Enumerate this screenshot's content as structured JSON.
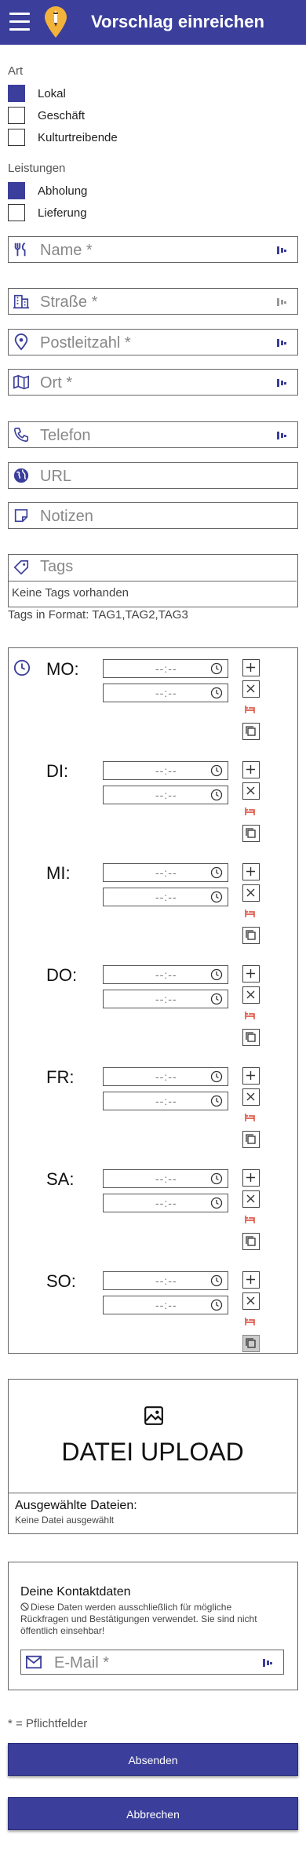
{
  "header": {
    "title": "Vorschlag einreichen"
  },
  "art": {
    "label": "Art",
    "options": [
      {
        "label": "Lokal",
        "checked": true
      },
      {
        "label": "Geschäft",
        "checked": false
      },
      {
        "label": "Kulturtreibende",
        "checked": false
      }
    ]
  },
  "leistungen": {
    "label": "Leistungen",
    "options": [
      {
        "label": "Abholung",
        "checked": true
      },
      {
        "label": "Lieferung",
        "checked": false
      }
    ]
  },
  "fields": {
    "name": "Name *",
    "strasse": "Straße *",
    "postleitzahl": "Postleitzahl *",
    "ort": "Ort *",
    "telefon": "Telefon",
    "url": "URL",
    "notizen": "Notizen",
    "tags": "Tags"
  },
  "tags": {
    "empty": "Keine Tags vorhanden",
    "hint": "Tags in Format: TAG1,TAG2,TAG3"
  },
  "hours": {
    "time_placeholder": "--:--",
    "days": [
      "MO:",
      "DI:",
      "MI:",
      "DO:",
      "FR:",
      "SA:",
      "SO:"
    ]
  },
  "upload": {
    "title": "DATEI UPLOAD",
    "selected_label": "Ausgewählte Dateien:",
    "none": "Keine Datei ausgewählt"
  },
  "contact": {
    "title": "Deine Kontaktdaten",
    "note": "Diese Daten werden ausschließlich für mögliche Rückfragen und Bestätigungen verwendet. Sie sind nicht öffentlich einsehbar!",
    "email": "E-Mail *"
  },
  "footnote": "* = Pflichtfelder",
  "buttons": {
    "submit": "Absenden",
    "cancel": "Abbrechen"
  },
  "colors": {
    "accent": "#3b3f9b",
    "logo": "#f3b23a",
    "delete_icon": "#d9412e"
  }
}
